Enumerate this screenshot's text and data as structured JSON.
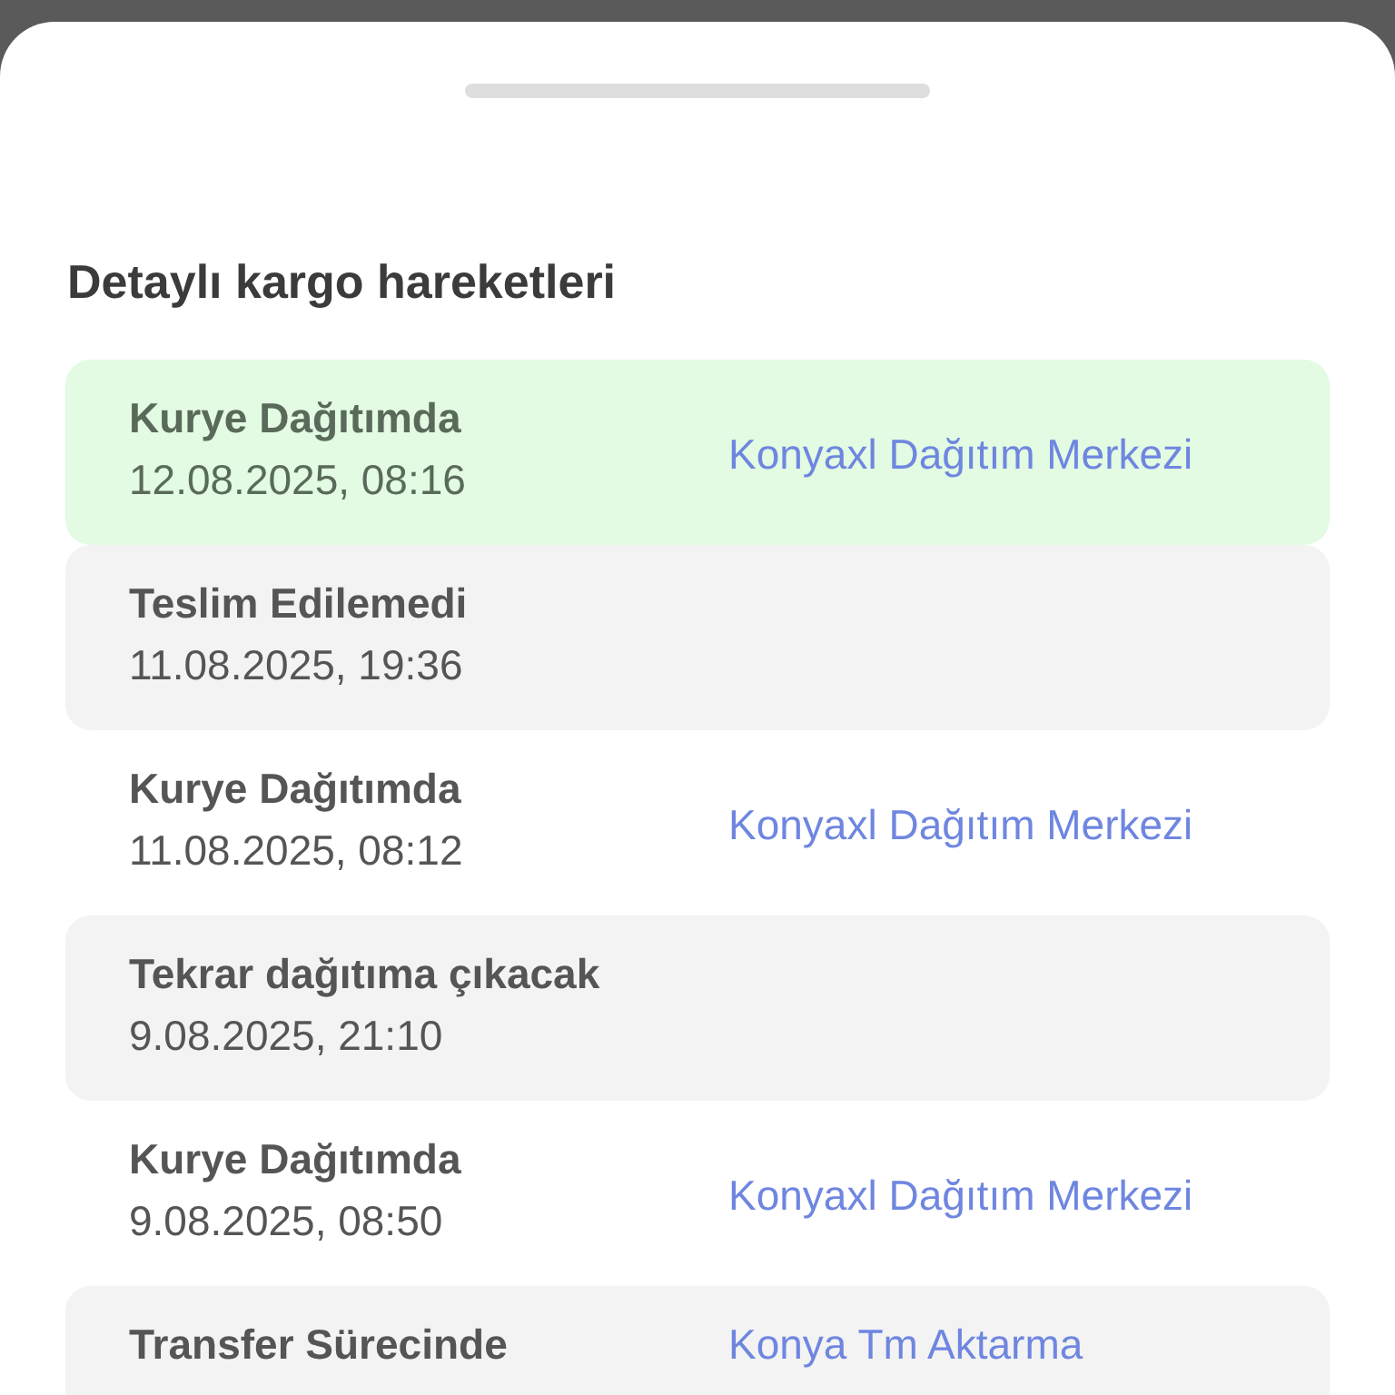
{
  "sheet": {
    "title": "Detaylı kargo hareketleri"
  },
  "movements": [
    {
      "kind": "current",
      "status": "Kurye Dağıtımda",
      "date": "12.08.2025, 08:16",
      "location": "Konyaxl Dağıtım Merkezi"
    },
    {
      "kind": "shaded",
      "status": "Teslim Edilemedi",
      "date": "11.08.2025, 19:36"
    },
    {
      "kind": "plain",
      "status": "Kurye Dağıtımda",
      "date": "11.08.2025, 08:12",
      "location": "Konyaxl Dağıtım Merkezi"
    },
    {
      "kind": "shaded",
      "status": "Tekrar dağıtıma çıkacak",
      "date": "9.08.2025, 21:10"
    },
    {
      "kind": "plain",
      "status": "Kurye Dağıtımda",
      "date": "9.08.2025, 08:50",
      "location": "Konyaxl Dağıtım Merkezi"
    },
    {
      "kind": "shaded",
      "status": "Transfer Sürecinde",
      "location": "Konya Tm Aktarma"
    }
  ]
}
